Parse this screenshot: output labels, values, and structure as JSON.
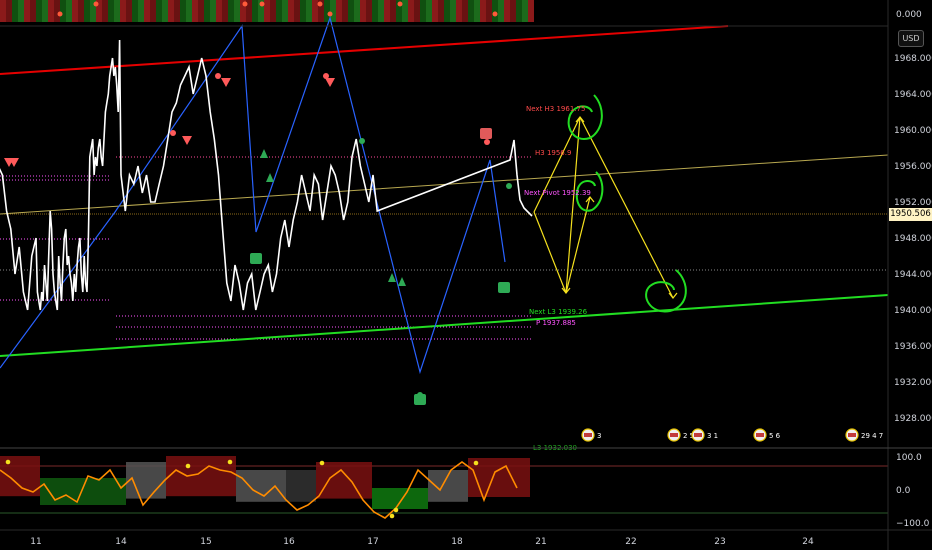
{
  "header": {
    "currency_button": "USD",
    "top_axis_value": "0.000"
  },
  "current_price": "1950.506",
  "colors": {
    "background": "#000000",
    "price_line": "#ffffff",
    "zigzag": "#2962ff",
    "upper_channel": "#e50000",
    "lower_channel": "#22dd22",
    "mid_channel": "#b8a850",
    "forecast_arrows": "#f5e11e",
    "forecast_circles": "#22dd22",
    "oscillator_line": "#ff8c00"
  },
  "annotations": {
    "next_h3": "Next H3 1961.75",
    "h3": "H3 1956.9",
    "next_pivot": "Next Pivot 1952.39",
    "next_l3": "Next L3 1939.26",
    "p": "P 1937.885",
    "l3": "L3 1932.030"
  },
  "event_badges": [
    {
      "x": 598,
      "label": "3"
    },
    {
      "x": 684,
      "label": "2 5"
    },
    {
      "x": 708,
      "label": "3 1"
    },
    {
      "x": 770,
      "label": "5 6"
    },
    {
      "x": 862,
      "label": "29 4 7"
    }
  ],
  "chart_data": {
    "type": "line",
    "price_axis": {
      "ylim": [
        1926,
        1972
      ],
      "ticks": [
        "1968.000",
        "1964.000",
        "1960.000",
        "1956.000",
        "1952.000",
        "1948.000",
        "1944.000",
        "1940.000",
        "1936.000",
        "1932.000",
        "1928.000"
      ]
    },
    "x_ticks": [
      {
        "label": "11",
        "day": 11
      },
      {
        "label": "14",
        "day": 14
      },
      {
        "label": "15",
        "day": 15
      },
      {
        "label": "16",
        "day": 16
      },
      {
        "label": "17",
        "day": 17
      },
      {
        "label": "18",
        "day": 18
      },
      {
        "label": "21",
        "day": 21
      },
      {
        "label": "22",
        "day": 22
      },
      {
        "label": "23",
        "day": 23
      },
      {
        "label": "24",
        "day": 24
      }
    ],
    "oscillator_axis": {
      "ylim": [
        -100,
        100
      ],
      "ticks": [
        "100.0",
        "0.0",
        "−100.0"
      ]
    },
    "series": [
      {
        "values": [
          [
            10.5,
            1963
          ],
          [
            10.55,
            1956
          ],
          [
            10.6,
            1955
          ],
          [
            10.65,
            1951
          ],
          [
            10.7,
            1949
          ],
          [
            10.75,
            1944
          ],
          [
            10.8,
            1947
          ],
          [
            10.85,
            1942
          ],
          [
            10.9,
            1940
          ],
          [
            10.95,
            1946
          ],
          [
            11.0,
            1948
          ],
          [
            11.05,
            1942
          ],
          [
            11.1,
            1941
          ],
          [
            11.15,
            1940
          ],
          [
            11.2,
            1942
          ],
          [
            11.25,
            1941
          ],
          [
            11.3,
            1945
          ],
          [
            11.35,
            1943
          ],
          [
            11.4,
            1941
          ],
          [
            11.45,
            1946
          ],
          [
            11.5,
            1951
          ],
          [
            11.55,
            1949
          ],
          [
            11.6,
            1944
          ],
          [
            11.65,
            1942
          ],
          [
            11.7,
            1941
          ],
          [
            11.75,
            1940
          ],
          [
            11.8,
            1946
          ],
          [
            11.85,
            1943
          ],
          [
            11.9,
            1941
          ],
          [
            11.95,
            1945
          ],
          [
            12.0,
            1948
          ],
          [
            12.05,
            1949
          ],
          [
            12.1,
            1945
          ],
          [
            12.15,
            1946
          ],
          [
            12.2,
            1944
          ],
          [
            12.25,
            1943
          ],
          [
            12.3,
            1941
          ],
          [
            12.35,
            1944
          ],
          [
            12.4,
            1942
          ],
          [
            12.45,
            1945
          ],
          [
            12.5,
            1947
          ],
          [
            12.55,
            1948
          ],
          [
            12.6,
            1944
          ],
          [
            12.65,
            1942
          ],
          [
            12.7,
            1946
          ],
          [
            12.75,
            1943
          ],
          [
            12.8,
            1942
          ],
          [
            12.85,
            1948
          ],
          [
            12.9,
            1957
          ],
          [
            12.95,
            1958
          ],
          [
            13.0,
            1959
          ],
          [
            13.05,
            1955
          ],
          [
            13.1,
            1957
          ],
          [
            13.15,
            1956
          ],
          [
            13.2,
            1958
          ],
          [
            13.25,
            1959
          ],
          [
            13.3,
            1957
          ],
          [
            13.35,
            1956
          ],
          [
            13.4,
            1959
          ],
          [
            13.45,
            1962
          ],
          [
            13.5,
            1963
          ],
          [
            13.55,
            1964
          ],
          [
            13.6,
            1966
          ],
          [
            13.65,
            1967
          ],
          [
            13.7,
            1968
          ],
          [
            13.75,
            1966
          ],
          [
            13.8,
            1967
          ],
          [
            13.85,
            1965
          ],
          [
            13.9,
            1962
          ],
          [
            13.95,
            1970
          ],
          [
            14.0,
            1955
          ],
          [
            14.05,
            1951
          ],
          [
            14.1,
            1955
          ],
          [
            14.15,
            1954
          ],
          [
            14.2,
            1956
          ],
          [
            14.25,
            1953
          ],
          [
            14.3,
            1955
          ],
          [
            14.35,
            1952
          ],
          [
            14.4,
            1952
          ],
          [
            14.45,
            1954
          ],
          [
            14.5,
            1956
          ],
          [
            14.55,
            1959
          ],
          [
            14.6,
            1962
          ],
          [
            14.65,
            1963
          ],
          [
            14.7,
            1965
          ],
          [
            14.75,
            1966
          ],
          [
            14.8,
            1967
          ],
          [
            14.85,
            1964
          ],
          [
            14.9,
            1966
          ],
          [
            14.95,
            1968
          ],
          [
            15.0,
            1966
          ],
          [
            15.05,
            1962
          ],
          [
            15.1,
            1959
          ],
          [
            15.15,
            1955
          ],
          [
            15.2,
            1949
          ],
          [
            15.25,
            1943
          ],
          [
            15.3,
            1941
          ],
          [
            15.35,
            1945
          ],
          [
            15.4,
            1943
          ],
          [
            15.45,
            1940
          ],
          [
            15.5,
            1943
          ],
          [
            15.55,
            1944
          ],
          [
            15.6,
            1940
          ],
          [
            15.65,
            1942
          ],
          [
            15.7,
            1944
          ],
          [
            15.75,
            1945
          ],
          [
            15.8,
            1942
          ],
          [
            15.85,
            1944
          ],
          [
            15.9,
            1948
          ],
          [
            15.95,
            1950
          ],
          [
            16.0,
            1947
          ],
          [
            16.05,
            1950
          ],
          [
            16.1,
            1952
          ],
          [
            16.15,
            1955
          ],
          [
            16.2,
            1953
          ],
          [
            16.25,
            1951
          ],
          [
            16.3,
            1955
          ],
          [
            16.35,
            1954
          ],
          [
            16.4,
            1950
          ],
          [
            16.45,
            1953
          ],
          [
            16.5,
            1956
          ],
          [
            16.55,
            1955
          ],
          [
            16.6,
            1953
          ],
          [
            16.65,
            1950
          ],
          [
            16.7,
            1952
          ],
          [
            16.75,
            1957
          ],
          [
            16.8,
            1959
          ],
          [
            16.85,
            1956
          ],
          [
            16.9,
            1954
          ],
          [
            16.95,
            1952
          ],
          [
            17.0,
            1955
          ],
          [
            17.05,
            1951
          ]
        ]
      },
      {
        "values": []
      }
    ]
  }
}
